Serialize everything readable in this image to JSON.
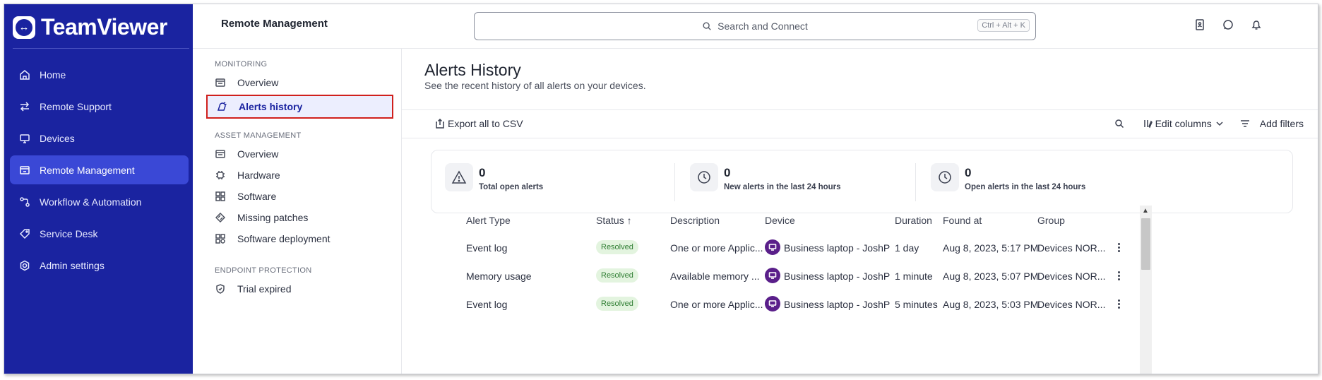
{
  "app": {
    "brand": "TeamViewer"
  },
  "colors": {
    "sidebar": "#1a23a0",
    "active_nav": "#3a48d6",
    "highlight_border": "#d0201c",
    "resolved_bg": "#e3f4df",
    "resolved_text": "#2e7d32",
    "device_icon": "#5a1f8a"
  },
  "leftnav": {
    "items": [
      {
        "label": "Home",
        "icon": "home-icon"
      },
      {
        "label": "Remote Support",
        "icon": "arrows-swap-icon"
      },
      {
        "label": "Devices",
        "icon": "monitor-icon"
      },
      {
        "label": "Remote Management",
        "icon": "remote-management-icon",
        "active": true
      },
      {
        "label": "Workflow & Automation",
        "icon": "workflow-icon"
      },
      {
        "label": "Service Desk",
        "icon": "tag-icon"
      },
      {
        "label": "Admin settings",
        "icon": "admin-gear-icon"
      }
    ]
  },
  "topbar": {
    "title": "Remote Management",
    "search_placeholder": "Search and Connect",
    "search_shortcut": "Ctrl + Alt + K",
    "icons": [
      "contacts-icon",
      "chat-icon",
      "bell-icon"
    ]
  },
  "subnav": {
    "monitoring_header": "MONITORING",
    "monitoring_items": [
      {
        "label": "Overview",
        "icon": "dashboard-icon"
      },
      {
        "label": "Alerts history",
        "icon": "alert-history-icon",
        "active": true
      }
    ],
    "asset_header": "ASSET MANAGEMENT",
    "asset_items": [
      {
        "label": "Overview",
        "icon": "dashboard-icon"
      },
      {
        "label": "Hardware",
        "icon": "chip-icon"
      },
      {
        "label": "Software",
        "icon": "grid-icon"
      },
      {
        "label": "Missing patches",
        "icon": "patch-icon"
      },
      {
        "label": "Software deployment",
        "icon": "deploy-icon"
      }
    ],
    "endpoint_header": "ENDPOINT PROTECTION",
    "endpoint_items": [
      {
        "label": "Trial expired",
        "icon": "shield-icon"
      }
    ]
  },
  "main": {
    "title": "Alerts History",
    "subtitle": "See the recent history of all alerts on your devices.",
    "toolbar": {
      "export_label": "Export all to CSV",
      "edit_columns_label": "Edit columns",
      "add_filters_label": "Add filters"
    },
    "stats": [
      {
        "value": "0",
        "label": "Total open alerts",
        "icon": "warning-icon"
      },
      {
        "value": "0",
        "label": "New alerts in the last 24 hours",
        "icon": "clock-icon"
      },
      {
        "value": "0",
        "label": "Open alerts in the last 24 hours",
        "icon": "clock-icon"
      }
    ],
    "table": {
      "columns": [
        "Alert Type",
        "Status ↑",
        "Description",
        "Device",
        "Duration",
        "Found at",
        "Group"
      ],
      "rows": [
        {
          "alert_type": "Event log",
          "status": "Resolved",
          "description": "One or more Applic...",
          "device": "Business laptop - JoshP",
          "duration": "1 day",
          "found_at": "Aug 8, 2023, 5:17 PM",
          "group": "Devices NOR..."
        },
        {
          "alert_type": "Memory usage",
          "status": "Resolved",
          "description": "Available memory ...",
          "device": "Business laptop - JoshP",
          "duration": "1 minute",
          "found_at": "Aug 8, 2023, 5:07 PM",
          "group": "Devices NOR..."
        },
        {
          "alert_type": "Event log",
          "status": "Resolved",
          "description": "One or more Applic...",
          "device": "Business laptop - JoshP",
          "duration": "5 minutes",
          "found_at": "Aug 8, 2023, 5:03 PM",
          "group": "Devices NOR..."
        }
      ]
    }
  }
}
